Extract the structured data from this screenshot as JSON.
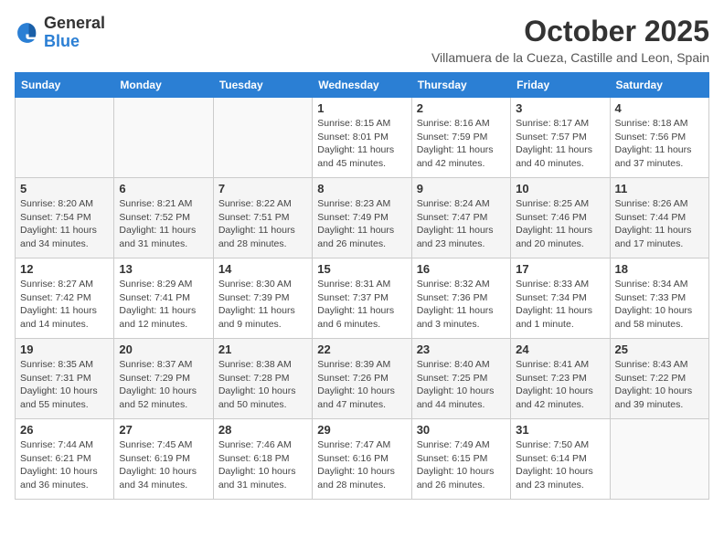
{
  "header": {
    "logo_general": "General",
    "logo_blue": "Blue",
    "month_title": "October 2025",
    "location": "Villamuera de la Cueza, Castille and Leon, Spain"
  },
  "weekdays": [
    "Sunday",
    "Monday",
    "Tuesday",
    "Wednesday",
    "Thursday",
    "Friday",
    "Saturday"
  ],
  "weeks": [
    [
      {
        "day": "",
        "info": ""
      },
      {
        "day": "",
        "info": ""
      },
      {
        "day": "",
        "info": ""
      },
      {
        "day": "1",
        "info": "Sunrise: 8:15 AM\nSunset: 8:01 PM\nDaylight: 11 hours\nand 45 minutes."
      },
      {
        "day": "2",
        "info": "Sunrise: 8:16 AM\nSunset: 7:59 PM\nDaylight: 11 hours\nand 42 minutes."
      },
      {
        "day": "3",
        "info": "Sunrise: 8:17 AM\nSunset: 7:57 PM\nDaylight: 11 hours\nand 40 minutes."
      },
      {
        "day": "4",
        "info": "Sunrise: 8:18 AM\nSunset: 7:56 PM\nDaylight: 11 hours\nand 37 minutes."
      }
    ],
    [
      {
        "day": "5",
        "info": "Sunrise: 8:20 AM\nSunset: 7:54 PM\nDaylight: 11 hours\nand 34 minutes."
      },
      {
        "day": "6",
        "info": "Sunrise: 8:21 AM\nSunset: 7:52 PM\nDaylight: 11 hours\nand 31 minutes."
      },
      {
        "day": "7",
        "info": "Sunrise: 8:22 AM\nSunset: 7:51 PM\nDaylight: 11 hours\nand 28 minutes."
      },
      {
        "day": "8",
        "info": "Sunrise: 8:23 AM\nSunset: 7:49 PM\nDaylight: 11 hours\nand 26 minutes."
      },
      {
        "day": "9",
        "info": "Sunrise: 8:24 AM\nSunset: 7:47 PM\nDaylight: 11 hours\nand 23 minutes."
      },
      {
        "day": "10",
        "info": "Sunrise: 8:25 AM\nSunset: 7:46 PM\nDaylight: 11 hours\nand 20 minutes."
      },
      {
        "day": "11",
        "info": "Sunrise: 8:26 AM\nSunset: 7:44 PM\nDaylight: 11 hours\nand 17 minutes."
      }
    ],
    [
      {
        "day": "12",
        "info": "Sunrise: 8:27 AM\nSunset: 7:42 PM\nDaylight: 11 hours\nand 14 minutes."
      },
      {
        "day": "13",
        "info": "Sunrise: 8:29 AM\nSunset: 7:41 PM\nDaylight: 11 hours\nand 12 minutes."
      },
      {
        "day": "14",
        "info": "Sunrise: 8:30 AM\nSunset: 7:39 PM\nDaylight: 11 hours\nand 9 minutes."
      },
      {
        "day": "15",
        "info": "Sunrise: 8:31 AM\nSunset: 7:37 PM\nDaylight: 11 hours\nand 6 minutes."
      },
      {
        "day": "16",
        "info": "Sunrise: 8:32 AM\nSunset: 7:36 PM\nDaylight: 11 hours\nand 3 minutes."
      },
      {
        "day": "17",
        "info": "Sunrise: 8:33 AM\nSunset: 7:34 PM\nDaylight: 11 hours\nand 1 minute."
      },
      {
        "day": "18",
        "info": "Sunrise: 8:34 AM\nSunset: 7:33 PM\nDaylight: 10 hours\nand 58 minutes."
      }
    ],
    [
      {
        "day": "19",
        "info": "Sunrise: 8:35 AM\nSunset: 7:31 PM\nDaylight: 10 hours\nand 55 minutes."
      },
      {
        "day": "20",
        "info": "Sunrise: 8:37 AM\nSunset: 7:29 PM\nDaylight: 10 hours\nand 52 minutes."
      },
      {
        "day": "21",
        "info": "Sunrise: 8:38 AM\nSunset: 7:28 PM\nDaylight: 10 hours\nand 50 minutes."
      },
      {
        "day": "22",
        "info": "Sunrise: 8:39 AM\nSunset: 7:26 PM\nDaylight: 10 hours\nand 47 minutes."
      },
      {
        "day": "23",
        "info": "Sunrise: 8:40 AM\nSunset: 7:25 PM\nDaylight: 10 hours\nand 44 minutes."
      },
      {
        "day": "24",
        "info": "Sunrise: 8:41 AM\nSunset: 7:23 PM\nDaylight: 10 hours\nand 42 minutes."
      },
      {
        "day": "25",
        "info": "Sunrise: 8:43 AM\nSunset: 7:22 PM\nDaylight: 10 hours\nand 39 minutes."
      }
    ],
    [
      {
        "day": "26",
        "info": "Sunrise: 7:44 AM\nSunset: 6:21 PM\nDaylight: 10 hours\nand 36 minutes."
      },
      {
        "day": "27",
        "info": "Sunrise: 7:45 AM\nSunset: 6:19 PM\nDaylight: 10 hours\nand 34 minutes."
      },
      {
        "day": "28",
        "info": "Sunrise: 7:46 AM\nSunset: 6:18 PM\nDaylight: 10 hours\nand 31 minutes."
      },
      {
        "day": "29",
        "info": "Sunrise: 7:47 AM\nSunset: 6:16 PM\nDaylight: 10 hours\nand 28 minutes."
      },
      {
        "day": "30",
        "info": "Sunrise: 7:49 AM\nSunset: 6:15 PM\nDaylight: 10 hours\nand 26 minutes."
      },
      {
        "day": "31",
        "info": "Sunrise: 7:50 AM\nSunset: 6:14 PM\nDaylight: 10 hours\nand 23 minutes."
      },
      {
        "day": "",
        "info": ""
      }
    ]
  ]
}
